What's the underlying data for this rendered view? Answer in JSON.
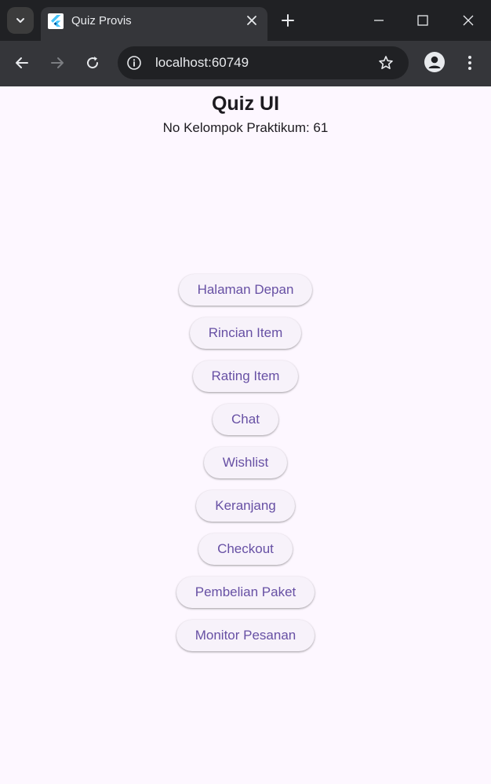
{
  "browser": {
    "tab_title": "Quiz Provis",
    "url": "localhost:60749",
    "icons": {
      "tab_search": "chevron-down-icon",
      "favicon": "flutter-logo-icon",
      "tab_close": "close-icon",
      "new_tab": "plus-icon",
      "back": "arrow-left-icon",
      "forward": "arrow-right-icon",
      "reload": "reload-icon",
      "site_info": "info-icon",
      "bookmark": "star-icon",
      "profile": "profile-icon",
      "menu": "kebab-menu-icon"
    }
  },
  "page": {
    "title": "Quiz UI",
    "subtitle": "No Kelompok Praktikum: 61",
    "buttons": [
      {
        "label": "Halaman Depan"
      },
      {
        "label": "Rincian Item"
      },
      {
        "label": "Rating Item"
      },
      {
        "label": "Chat"
      },
      {
        "label": "Wishlist"
      },
      {
        "label": "Keranjang"
      },
      {
        "label": "Checkout"
      },
      {
        "label": "Pembelian Paket"
      },
      {
        "label": "Monitor Pesanan"
      }
    ]
  },
  "colors": {
    "background": "#fdf7ff",
    "button_bg": "#f7f2fa",
    "button_text": "#6750a4",
    "text": "#1d1b20",
    "chrome_dark": "#202124",
    "chrome_toolbar": "#35363a"
  }
}
